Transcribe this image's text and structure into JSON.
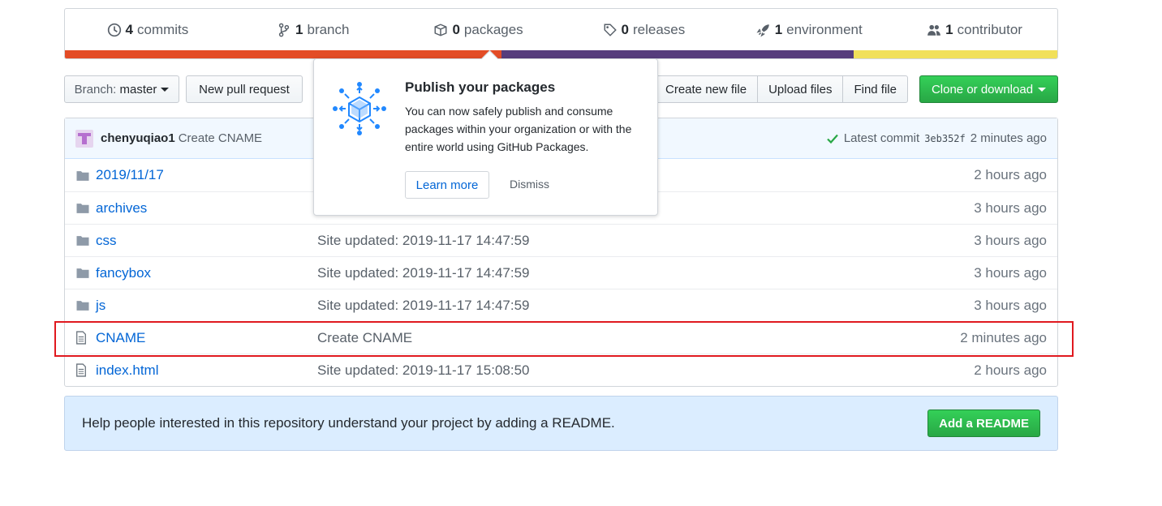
{
  "colors": {
    "accent": "#0366d6",
    "green": "#28a745",
    "lang": [
      "#e34c26",
      "#563d7c",
      "#f1e05a"
    ]
  },
  "summary": {
    "items": [
      {
        "count": "4",
        "label": "commits",
        "icon": "history-icon"
      },
      {
        "count": "1",
        "label": "branch",
        "icon": "git-branch-icon"
      },
      {
        "count": "0",
        "label": "packages",
        "icon": "package-icon"
      },
      {
        "count": "0",
        "label": "releases",
        "icon": "tag-icon"
      },
      {
        "count": "1",
        "label": "environment",
        "icon": "rocket-icon"
      },
      {
        "count": "1",
        "label": "contributor",
        "icon": "people-icon"
      }
    ],
    "language_fractions": [
      0.44,
      0.355,
      0.205
    ]
  },
  "toolbar": {
    "branch_prefix": "Branch:",
    "branch_name": "master",
    "new_pull_request": "New pull request",
    "create_new_file": "Create new file",
    "upload_files": "Upload files",
    "find_file": "Find file",
    "clone_or_download": "Clone or download"
  },
  "commit": {
    "author": "chenyuqiao1",
    "message": "Create CNAME",
    "latest_label": "Latest commit",
    "sha": "3eb352f",
    "age": "2 minutes ago"
  },
  "files": [
    {
      "type": "folder",
      "name": "2019/11/17",
      "message": "",
      "age": "2 hours ago"
    },
    {
      "type": "folder",
      "name": "archives",
      "message": "",
      "age": "3 hours ago"
    },
    {
      "type": "folder",
      "name": "css",
      "message": "Site updated: 2019-11-17 14:47:59",
      "age": "3 hours ago"
    },
    {
      "type": "folder",
      "name": "fancybox",
      "message": "Site updated: 2019-11-17 14:47:59",
      "age": "3 hours ago"
    },
    {
      "type": "folder",
      "name": "js",
      "message": "Site updated: 2019-11-17 14:47:59",
      "age": "3 hours ago"
    },
    {
      "type": "file",
      "name": "CNAME",
      "message": "Create CNAME",
      "age": "2 minutes ago"
    },
    {
      "type": "file",
      "name": "index.html",
      "message": "Site updated: 2019-11-17 15:08:50",
      "age": "2 hours ago"
    }
  ],
  "readme": {
    "text": "Help people interested in this repository understand your project by adding a README.",
    "button": "Add a README"
  },
  "popover": {
    "title": "Publish your packages",
    "body": "You can now safely publish and consume packages within your organization or with the entire world using GitHub Packages.",
    "learn_more": "Learn more",
    "dismiss": "Dismiss"
  }
}
